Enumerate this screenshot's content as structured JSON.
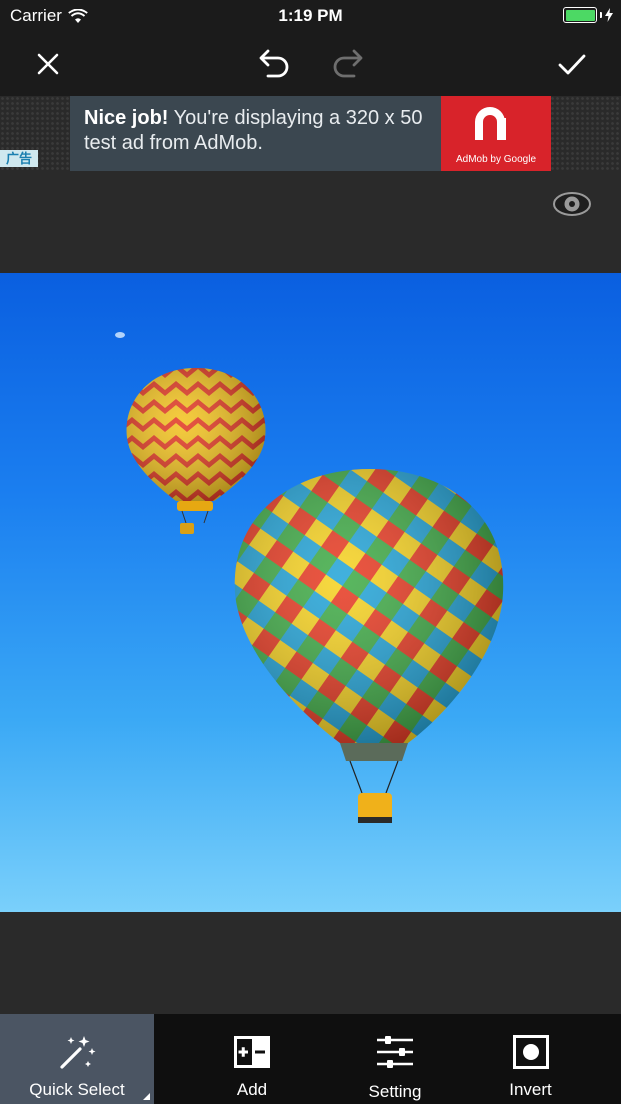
{
  "status": {
    "carrier": "Carrier",
    "time": "1:19 PM"
  },
  "toolbar": {
    "close_icon": "close-icon",
    "undo_icon": "undo-icon",
    "redo_icon": "redo-icon",
    "confirm_icon": "checkmark-icon"
  },
  "ad": {
    "headline": "Nice job!",
    "body": " You're displaying a 320 x 50 test ad from AdMob.",
    "logo_caption": "AdMob by Google",
    "label": "广告",
    "brand_color": "#d8232a"
  },
  "canvas": {
    "eye_icon": "eye-icon",
    "sky_top": "#0a5fe0",
    "sky_bottom": "#7ad0fb"
  },
  "tabs": [
    {
      "label": "Quick Select",
      "icon": "magic-wand-icon",
      "active": true
    },
    {
      "label": "Add",
      "icon": "add-subtract-icon",
      "active": false
    },
    {
      "label": "Setting",
      "icon": "sliders-icon",
      "active": false
    },
    {
      "label": "Invert",
      "icon": "invert-icon",
      "active": false
    }
  ]
}
